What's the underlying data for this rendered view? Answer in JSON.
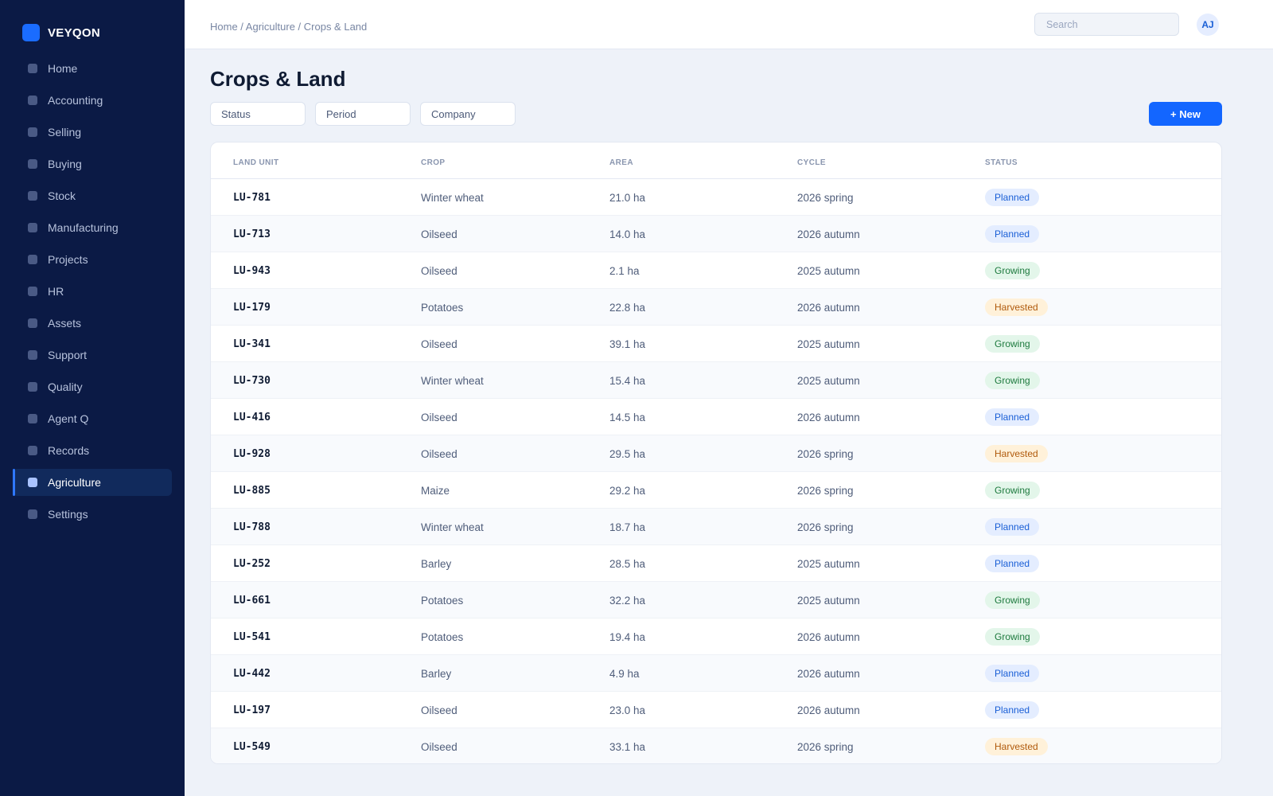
{
  "brand": {
    "name": "VEYQON",
    "color": "#1a6cff"
  },
  "sidebar": {
    "items": [
      {
        "label": "Home",
        "active": false
      },
      {
        "label": "Accounting",
        "active": false
      },
      {
        "label": "Selling",
        "active": false
      },
      {
        "label": "Buying",
        "active": false
      },
      {
        "label": "Stock",
        "active": false
      },
      {
        "label": "Manufacturing",
        "active": false
      },
      {
        "label": "Projects",
        "active": false
      },
      {
        "label": "HR",
        "active": false
      },
      {
        "label": "Assets",
        "active": false
      },
      {
        "label": "Support",
        "active": false
      },
      {
        "label": "Quality",
        "active": false
      },
      {
        "label": "Agent Q",
        "active": false
      },
      {
        "label": "Records",
        "active": false
      },
      {
        "label": "Agriculture",
        "active": true
      },
      {
        "label": "Settings",
        "active": false
      }
    ]
  },
  "header": {
    "breadcrumb": "Home / Agriculture / Crops & Land",
    "search_placeholder": "Search",
    "avatar_initials": "AJ"
  },
  "page": {
    "title": "Crops & Land",
    "filters": [
      "Status",
      "Period",
      "Company"
    ],
    "new_button": "+ New"
  },
  "table": {
    "columns": [
      "LAND UNIT",
      "CROP",
      "AREA",
      "CYCLE",
      "STATUS"
    ],
    "rows": [
      {
        "unit": "LU-781",
        "crop": "Winter wheat",
        "area": "21.0 ha",
        "cycle": "2026 spring",
        "status": "Planned"
      },
      {
        "unit": "LU-713",
        "crop": "Oilseed",
        "area": "14.0 ha",
        "cycle": "2026 autumn",
        "status": "Planned"
      },
      {
        "unit": "LU-943",
        "crop": "Oilseed",
        "area": "2.1 ha",
        "cycle": "2025 autumn",
        "status": "Growing"
      },
      {
        "unit": "LU-179",
        "crop": "Potatoes",
        "area": "22.8 ha",
        "cycle": "2026 autumn",
        "status": "Harvested"
      },
      {
        "unit": "LU-341",
        "crop": "Oilseed",
        "area": "39.1 ha",
        "cycle": "2025 autumn",
        "status": "Growing"
      },
      {
        "unit": "LU-730",
        "crop": "Winter wheat",
        "area": "15.4 ha",
        "cycle": "2025 autumn",
        "status": "Growing"
      },
      {
        "unit": "LU-416",
        "crop": "Oilseed",
        "area": "14.5 ha",
        "cycle": "2026 autumn",
        "status": "Planned"
      },
      {
        "unit": "LU-928",
        "crop": "Oilseed",
        "area": "29.5 ha",
        "cycle": "2026 spring",
        "status": "Harvested"
      },
      {
        "unit": "LU-885",
        "crop": "Maize",
        "area": "29.2 ha",
        "cycle": "2026 spring",
        "status": "Growing"
      },
      {
        "unit": "LU-788",
        "crop": "Winter wheat",
        "area": "18.7 ha",
        "cycle": "2026 spring",
        "status": "Planned"
      },
      {
        "unit": "LU-252",
        "crop": "Barley",
        "area": "28.5 ha",
        "cycle": "2025 autumn",
        "status": "Planned"
      },
      {
        "unit": "LU-661",
        "crop": "Potatoes",
        "area": "32.2 ha",
        "cycle": "2025 autumn",
        "status": "Growing"
      },
      {
        "unit": "LU-541",
        "crop": "Potatoes",
        "area": "19.4 ha",
        "cycle": "2026 autumn",
        "status": "Growing"
      },
      {
        "unit": "LU-442",
        "crop": "Barley",
        "area": "4.9 ha",
        "cycle": "2026 autumn",
        "status": "Planned"
      },
      {
        "unit": "LU-197",
        "crop": "Oilseed",
        "area": "23.0 ha",
        "cycle": "2026 autumn",
        "status": "Planned"
      },
      {
        "unit": "LU-549",
        "crop": "Oilseed",
        "area": "33.1 ha",
        "cycle": "2026 spring",
        "status": "Harvested"
      }
    ]
  },
  "colors": {
    "sidebar_bg": "#0b1a45",
    "accent": "#1366ff",
    "planned": "#1a5fd6",
    "growing": "#1d7a3e",
    "harvested": "#b05a0c"
  }
}
